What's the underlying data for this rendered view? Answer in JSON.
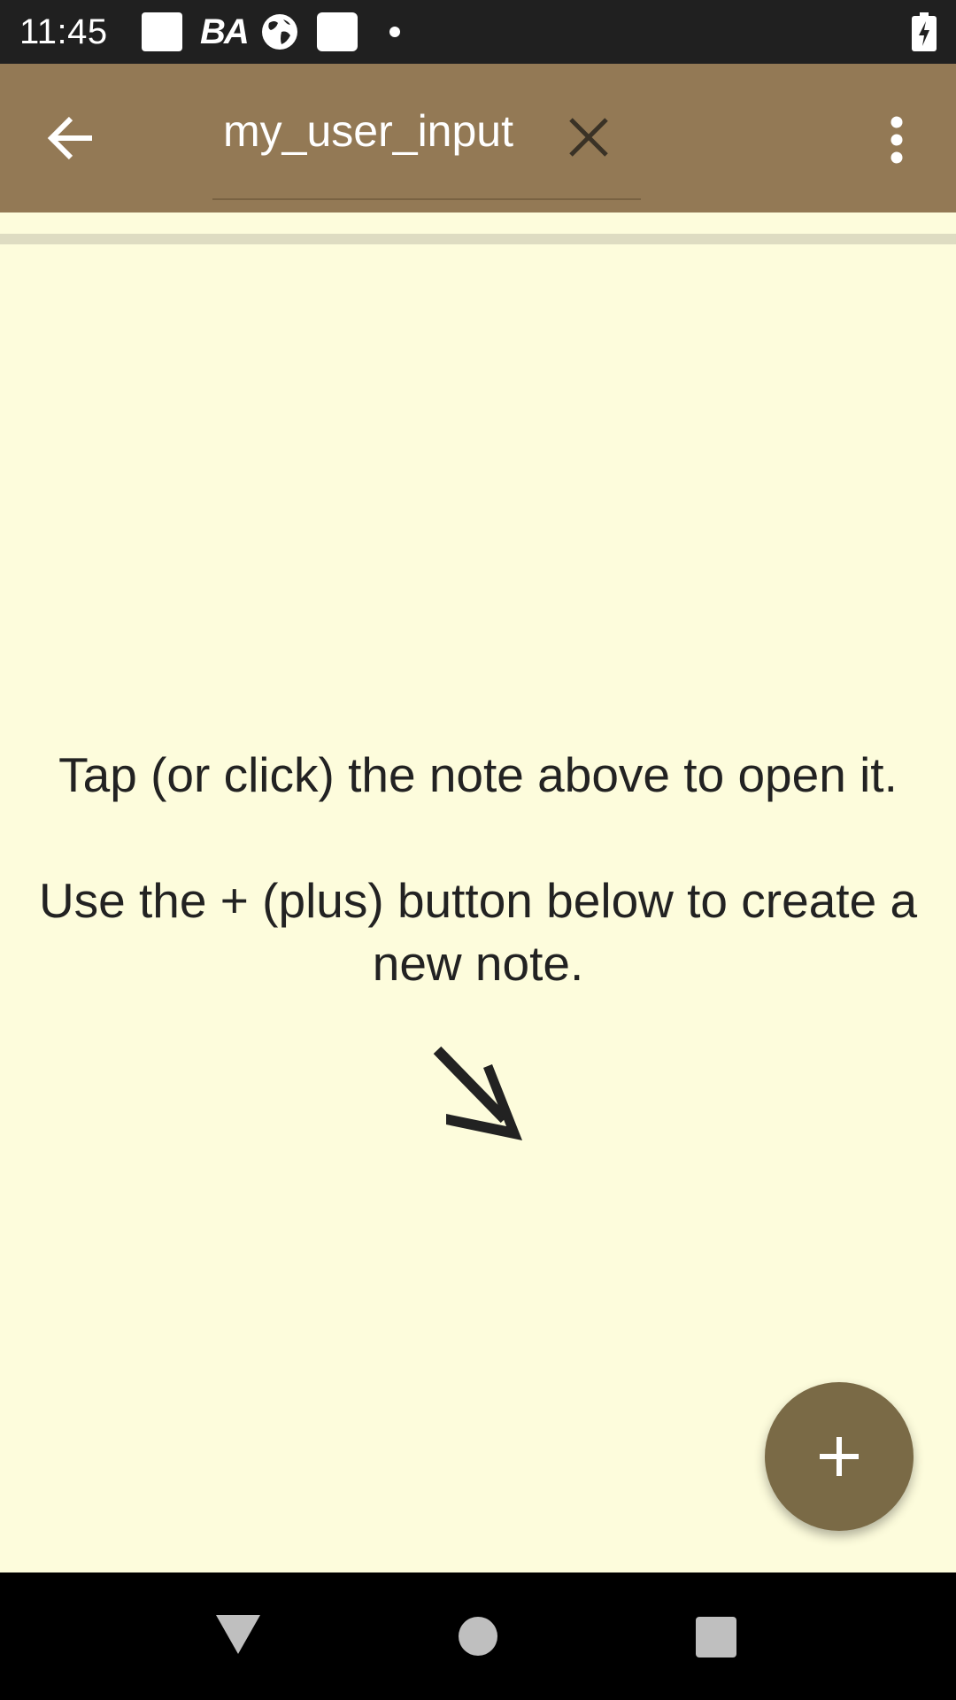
{
  "status_bar": {
    "time": "11:45",
    "indicator": "BA",
    "icons": [
      "notification-square-icon",
      "globe-icon",
      "notification-square-icon",
      "dot-icon",
      "battery-charging-icon"
    ]
  },
  "app_bar": {
    "back_icon": "arrow-left-icon",
    "search": {
      "value": "my_user_input"
    },
    "clear_icon": "close-icon",
    "overflow_icon": "more-vert-icon"
  },
  "empty_state": {
    "line1": "Tap (or click) the note above to open it.",
    "line2": "Use the + (plus) button below to create a new note.",
    "hint_icon": "arrow-down-right-icon"
  },
  "fab": {
    "icon": "plus-icon"
  },
  "nav_bar": {
    "icons": [
      "back-triangle-icon",
      "home-circle-icon",
      "recents-square-icon"
    ]
  },
  "colors": {
    "status_bar": "#202020",
    "app_bar": "#937955",
    "background": "#fdfcdc",
    "fab": "#7a6a46",
    "text": "#222222"
  }
}
